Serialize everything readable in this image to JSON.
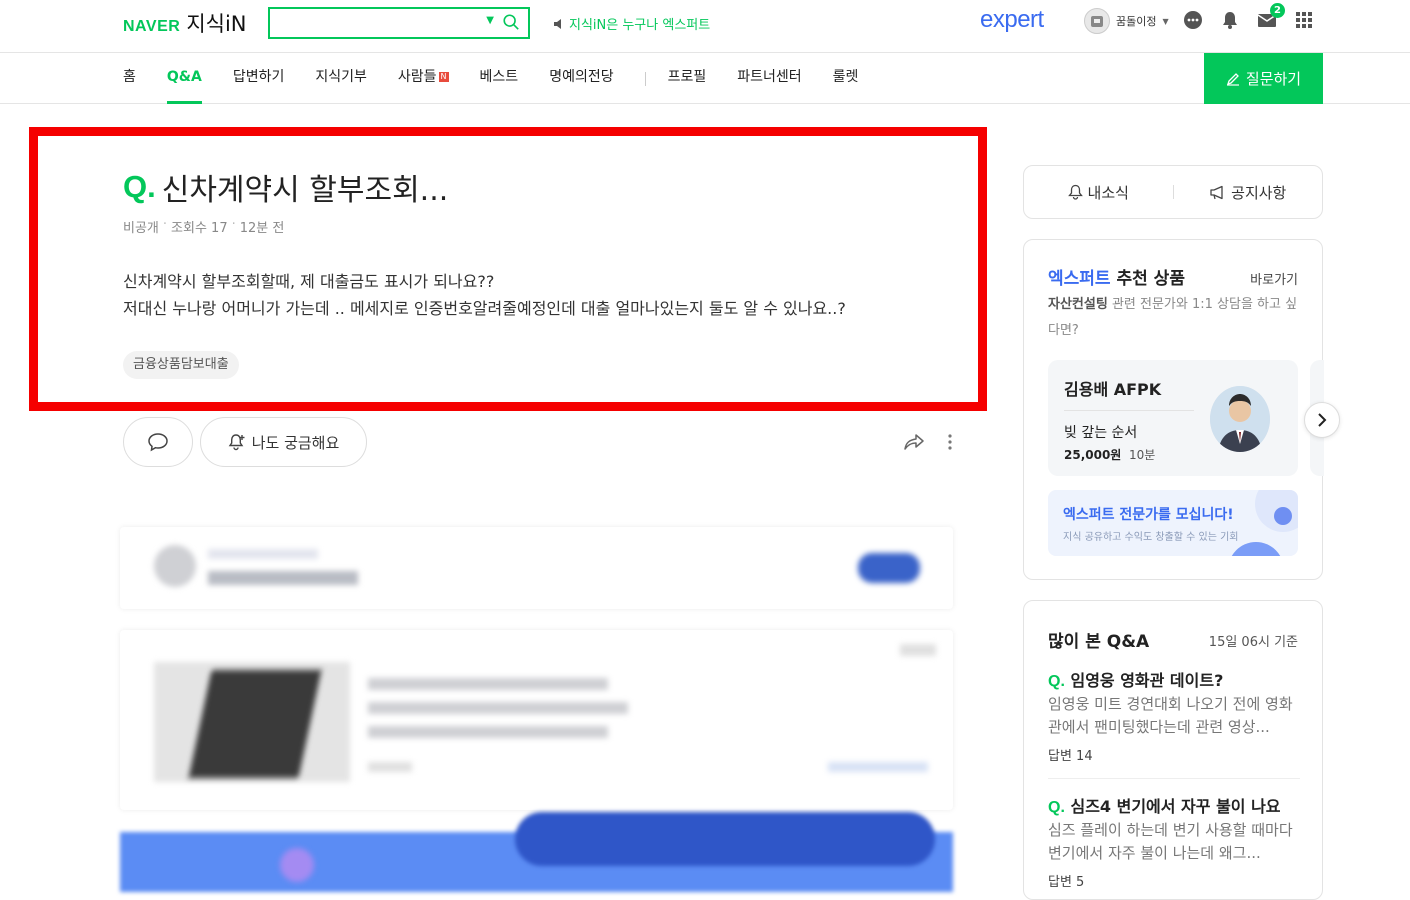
{
  "header": {
    "brand": "NAVER",
    "service": "지식iN",
    "search_placeholder": "",
    "notice": "지식iN은 누구나 엑스퍼트",
    "expert_logo": "expert",
    "username": "꿈돌이정",
    "mail_count": "2"
  },
  "nav": {
    "items": [
      "홈",
      "Q&A",
      "답변하기",
      "지식기부",
      "사람들",
      "베스트",
      "명예의전당",
      "프로필",
      "파트너센터",
      "룰렛"
    ],
    "new_badge": "N",
    "ask_button": "질문하기"
  },
  "question": {
    "q_mark": "Q.",
    "title": "신차계약시 할부조회...",
    "meta": [
      "비공개",
      "조회수 17",
      "12분 전"
    ],
    "body": [
      "신차계약시 할부조회할때, 제 대출금도 표시가 되나요??",
      "저대신 누나랑 어머니가 가는데 .. 메세지로 인증번호알려줄예정인데 대출 얼마나있는지 둘도 알 수 있나요..?"
    ],
    "tag": "금융상품담보대출",
    "curious_label": "나도 궁금해요"
  },
  "sidebar": {
    "tabs": [
      "내소식",
      "공지사항"
    ],
    "expert": {
      "title_blue": "엑스퍼트",
      "title_rest": " 추천 상품",
      "go_label": "바로가기",
      "sub_bold": "자산컨설팅",
      "sub_rest": " 관련 전문가와 1:1 상담을 하고 싶다면?",
      "card": {
        "name": "김용배 AFPK",
        "product": "빚 갚는 순서",
        "price": "25,000원",
        "duration": "10분"
      },
      "banner_title": "엑스퍼트 전문가를 모십니다!",
      "banner_sub": "지식 공유하고 수익도 창출할 수 있는 기회"
    },
    "popular": {
      "title": "많이 본 Q&A",
      "time": "15일 06시 기준",
      "items": [
        {
          "q": "Q.",
          "title": "임영웅 영화관 데이트?",
          "body": "임영웅 미트 경연대회 나오기 전에 영화관에서 팬미팅했다는데 관련 영상...",
          "answers": "답변 14"
        },
        {
          "q": "Q.",
          "title": "심즈4 변기에서 자꾸 불이 나요",
          "body": "심즈 플레이 하는데 변기 사용할 때마다 변기에서 자주 불이 나는데 왜그...",
          "answers": "답변 5"
        }
      ]
    }
  },
  "colors": {
    "naver_green": "#03c75a",
    "expert_blue": "#3a6bf0",
    "highlight_red": "#f50000"
  }
}
